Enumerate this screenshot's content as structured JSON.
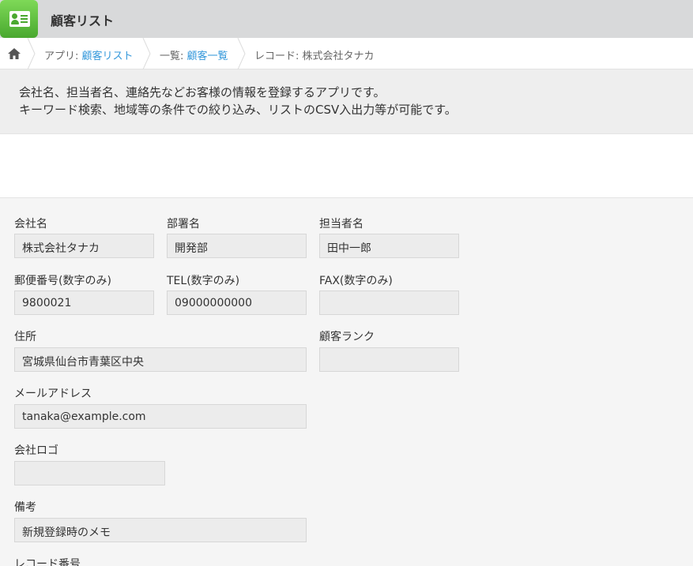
{
  "header": {
    "title": "顧客リスト",
    "app_icon": "customer-card-icon",
    "accent_color": "#5fbf3f"
  },
  "breadcrumb": {
    "home_icon": "home-icon",
    "app_prefix": "アプリ: ",
    "app_link": "顧客リスト",
    "list_prefix": "一覧: ",
    "list_link": "顧客一覧",
    "record": "レコード: 株式会社タナカ"
  },
  "description": {
    "line1": "会社名、担当者名、連絡先などお客様の情報を登録するアプリです。",
    "line2": "キーワード検索、地域等の条件での絞り込み、リストのCSV入出力等が可能です。"
  },
  "fields": {
    "company": {
      "label": "会社名",
      "value": "株式会社タナカ"
    },
    "department": {
      "label": "部署名",
      "value": "開発部"
    },
    "person": {
      "label": "担当者名",
      "value": "田中一郎"
    },
    "postal": {
      "label": "郵便番号(数字のみ)",
      "value": "9800021"
    },
    "tel": {
      "label": "TEL(数字のみ)",
      "value": "09000000000"
    },
    "fax": {
      "label": "FAX(数字のみ)",
      "value": ""
    },
    "address": {
      "label": "住所",
      "value": "宮城県仙台市青葉区中央"
    },
    "rank": {
      "label": "顧客ランク",
      "value": ""
    },
    "email": {
      "label": "メールアドレス",
      "value": "tanaka@example.com"
    },
    "logo": {
      "label": "会社ロゴ",
      "value": ""
    },
    "notes": {
      "label": "備考",
      "value": "新規登録時のメモ"
    },
    "record_no": {
      "label": "レコード番号"
    }
  }
}
